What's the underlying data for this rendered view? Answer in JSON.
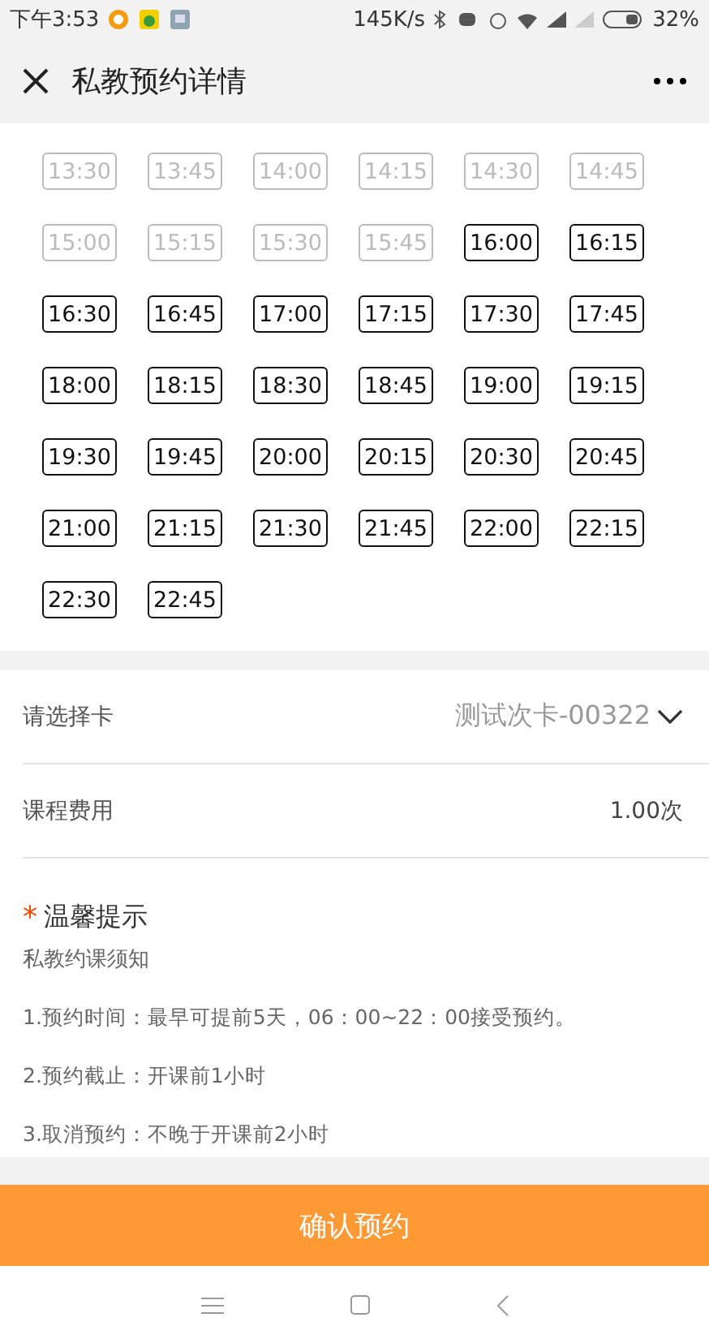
{
  "status_bar": {
    "time": "下午3:53",
    "speed": "145K/s",
    "battery": "32%"
  },
  "header": {
    "title": "私教预约详情"
  },
  "time_slots": [
    {
      "label": "13:30",
      "disabled": true
    },
    {
      "label": "13:45",
      "disabled": true
    },
    {
      "label": "14:00",
      "disabled": true
    },
    {
      "label": "14:15",
      "disabled": true
    },
    {
      "label": "14:30",
      "disabled": true
    },
    {
      "label": "14:45",
      "disabled": true
    },
    {
      "label": "15:00",
      "disabled": true
    },
    {
      "label": "15:15",
      "disabled": true
    },
    {
      "label": "15:30",
      "disabled": true
    },
    {
      "label": "15:45",
      "disabled": true
    },
    {
      "label": "16:00",
      "disabled": false
    },
    {
      "label": "16:15",
      "disabled": false
    },
    {
      "label": "16:30",
      "disabled": false
    },
    {
      "label": "16:45",
      "disabled": false
    },
    {
      "label": "17:00",
      "disabled": false
    },
    {
      "label": "17:15",
      "disabled": false
    },
    {
      "label": "17:30",
      "disabled": false
    },
    {
      "label": "17:45",
      "disabled": false
    },
    {
      "label": "18:00",
      "disabled": false
    },
    {
      "label": "18:15",
      "disabled": false
    },
    {
      "label": "18:30",
      "disabled": false
    },
    {
      "label": "18:45",
      "disabled": false
    },
    {
      "label": "19:00",
      "disabled": false
    },
    {
      "label": "19:15",
      "disabled": false
    },
    {
      "label": "19:30",
      "disabled": false
    },
    {
      "label": "19:45",
      "disabled": false
    },
    {
      "label": "20:00",
      "disabled": false
    },
    {
      "label": "20:15",
      "disabled": false
    },
    {
      "label": "20:30",
      "disabled": false
    },
    {
      "label": "20:45",
      "disabled": false
    },
    {
      "label": "21:00",
      "disabled": false
    },
    {
      "label": "21:15",
      "disabled": false
    },
    {
      "label": "21:30",
      "disabled": false
    },
    {
      "label": "21:45",
      "disabled": false
    },
    {
      "label": "22:00",
      "disabled": false
    },
    {
      "label": "22:15",
      "disabled": false
    },
    {
      "label": "22:30",
      "disabled": false
    },
    {
      "label": "22:45",
      "disabled": false
    }
  ],
  "card_select": {
    "label": "请选择卡",
    "value": "测试次卡-00322"
  },
  "fee": {
    "label": "课程费用",
    "value": "1.00次"
  },
  "tips": {
    "mark": "*",
    "title": "温馨提示",
    "subtitle": "私教约课须知",
    "items": [
      "1.预约时间：最早可提前5天，06：00~22：00接受预约。",
      "2.预约截止：开课前1小时",
      "3.取消预约：不晚于开课前2小时"
    ]
  },
  "confirm_button": "确认预约"
}
